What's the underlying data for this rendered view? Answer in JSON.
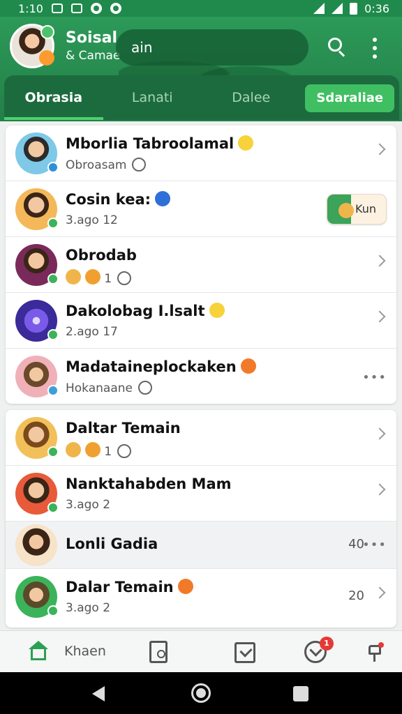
{
  "status_bar": {
    "time": "1:10",
    "right_text": "0:36"
  },
  "header": {
    "title": "Soisal",
    "subtitle": "& Camae",
    "search_text": "ain"
  },
  "tabs": [
    {
      "label": "Obrasia",
      "active": true
    },
    {
      "label": "Lanati",
      "active": false
    },
    {
      "label": "Dalee",
      "active": false
    },
    {
      "label": "Sdaraliae",
      "active": false,
      "pill": true
    }
  ],
  "list_primary": [
    {
      "name": "Mborlia Tabroolamal",
      "sub": "Obroasam",
      "right": "chevron",
      "avatar_color": "#7ec8e8",
      "dot_color": "#2f8fd8"
    },
    {
      "name": "Cosin kea:",
      "sub": "3.ago 12",
      "right": "badge",
      "badge_text": "Kun",
      "avatar_color": "#f4b85a",
      "dot_color": "#3bb35a"
    },
    {
      "name": "Obrodab",
      "sub": "1",
      "right": "chevron",
      "avatar_color": "#7a2a5a",
      "dot_color": "#3bb35a"
    },
    {
      "name": "Dakolobag I.lsalt",
      "sub": "2.ago 17",
      "right": "chevron",
      "avatar_color": "#3a2a9a",
      "dot_color": "#3bb35a"
    },
    {
      "name": "Madataineplockaken",
      "sub": "Hokanaane",
      "right": "more",
      "avatar_color": "#f0b0b8",
      "dot_color": "#3aa0d8"
    }
  ],
  "list_secondary": [
    {
      "name": "Daltar Temain",
      "sub": "1",
      "right": "chevron",
      "avatar_color": "#f2c05a",
      "dot_color": "#3bb35a"
    },
    {
      "name": "Nanktahabden Mam",
      "sub": "3.ago 2",
      "right": "chevron",
      "avatar_color": "#e85a3a",
      "dot_color": "#3bb35a"
    },
    {
      "name": "Lonli Gadia",
      "sub": "",
      "count": "40",
      "right": "more",
      "avatar_color": "#f6e3c8",
      "dot_color": ""
    },
    {
      "name": "Dalar Temain",
      "sub": "3.ago 2",
      "count": "20",
      "right": "chevron",
      "avatar_color": "#5a4a2a",
      "dot_color": "#3bb35a"
    }
  ],
  "bottom_nav": {
    "home_label": "Khaen",
    "notifications_count": "1"
  },
  "colors": {
    "brand_green": "#2c9a58",
    "tab_bar": "#1c6b3e",
    "accent_green": "#3fbf62",
    "alert_red": "#e53935"
  }
}
